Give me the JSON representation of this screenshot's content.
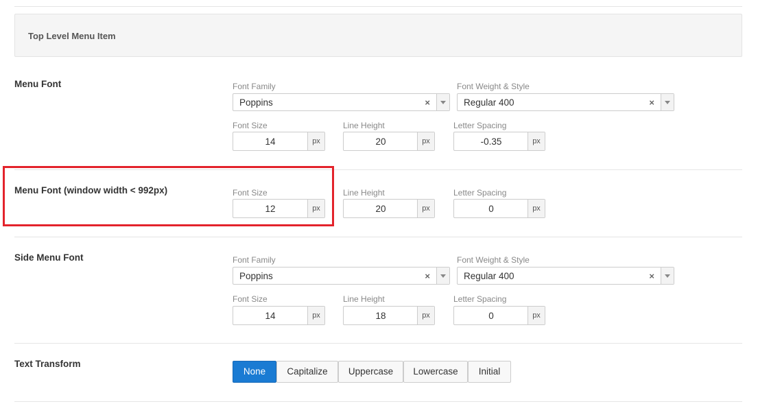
{
  "header": {
    "title": "Top Level Menu Item"
  },
  "menu_font": {
    "label": "Menu Font",
    "font_family_label": "Font Family",
    "font_family_value": "Poppins",
    "font_weight_label": "Font Weight & Style",
    "font_weight_value": "Regular 400",
    "font_size_label": "Font Size",
    "font_size_value": "14",
    "line_height_label": "Line Height",
    "line_height_value": "20",
    "letter_spacing_label": "Letter Spacing",
    "letter_spacing_value": "-0.35",
    "unit": "px"
  },
  "menu_font_small": {
    "label": "Menu Font (window width < 992px)",
    "font_size_label": "Font Size",
    "font_size_value": "12",
    "line_height_label": "Line Height",
    "line_height_value": "20",
    "letter_spacing_label": "Letter Spacing",
    "letter_spacing_value": "0",
    "unit": "px"
  },
  "side_menu_font": {
    "label": "Side Menu Font",
    "font_family_label": "Font Family",
    "font_family_value": "Poppins",
    "font_weight_label": "Font Weight & Style",
    "font_weight_value": "Regular 400",
    "font_size_label": "Font Size",
    "font_size_value": "14",
    "line_height_label": "Line Height",
    "line_height_value": "18",
    "letter_spacing_label": "Letter Spacing",
    "letter_spacing_value": "0",
    "unit": "px"
  },
  "text_transform": {
    "label": "Text Transform",
    "options": [
      "None",
      "Capitalize",
      "Uppercase",
      "Lowercase",
      "Initial"
    ],
    "selected": "None"
  },
  "icons": {
    "clear": "×",
    "dropdown": "chevron-down-icon"
  },
  "colors": {
    "accent": "#1a7bd3",
    "highlight": "#e3232b"
  }
}
